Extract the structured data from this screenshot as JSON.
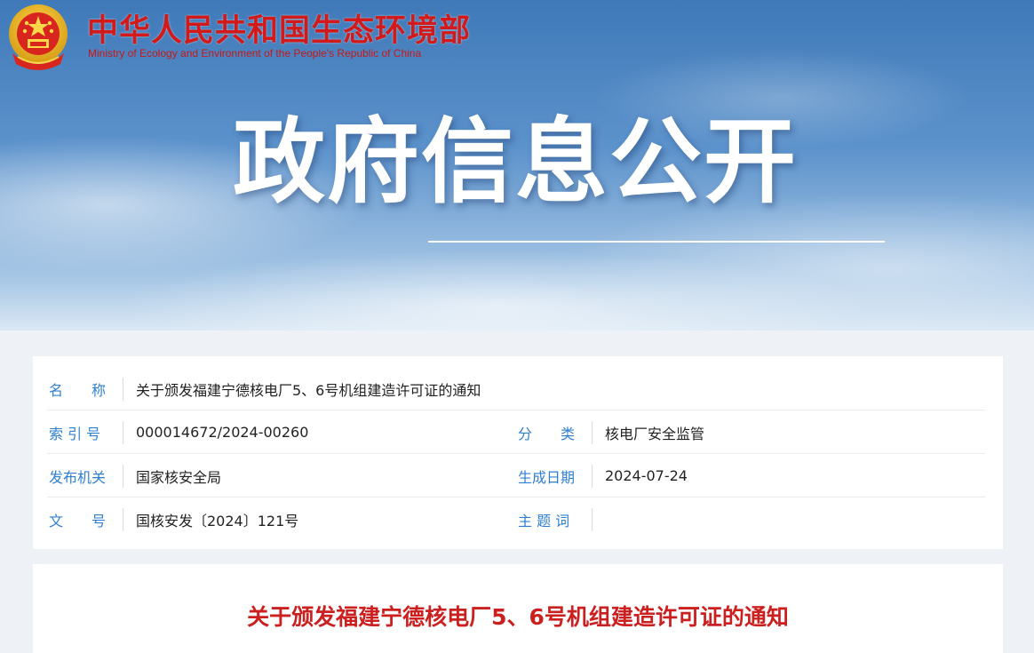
{
  "header": {
    "org_name_cn": "中华人民共和国生态环境部",
    "org_name_en": "Ministry of Ecology and Environment of the People's Republic of China",
    "hero_title": "政府信息公开",
    "emblem_icon": "national-emblem-icon"
  },
  "info": {
    "name_label": "名　　称",
    "name_value": "关于颁发福建宁德核电厂5、6号机组建造许可证的通知",
    "index_label": "索 引 号",
    "index_value": "000014672/2024-00260",
    "category_label": "分　　类",
    "category_value": "核电厂安全监管",
    "publisher_label": "发布机关",
    "publisher_value": "国家核安全局",
    "date_label": "生成日期",
    "date_value": "2024-07-24",
    "docno_label": "文　　号",
    "docno_value": "国核安发〔2024〕121号",
    "keywords_label": "主 题 词",
    "keywords_value": ""
  },
  "document": {
    "title": "关于颁发福建宁德核电厂5、6号机组建造许可证的通知"
  },
  "colors": {
    "brand_red": "#d21a1a",
    "label_blue": "#2f7fd1",
    "title_red": "#cc1f1f"
  }
}
